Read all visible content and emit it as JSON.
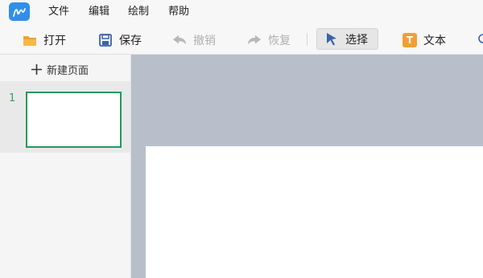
{
  "menu": {
    "items": [
      {
        "label": "文件"
      },
      {
        "label": "编辑"
      },
      {
        "label": "绘制"
      },
      {
        "label": "帮助"
      }
    ]
  },
  "toolbar": {
    "open": {
      "label": "打开",
      "icon": "folder-icon"
    },
    "save": {
      "label": "保存",
      "icon": "save-icon"
    },
    "undo": {
      "label": "撤销",
      "icon": "undo-icon",
      "state": "disabled"
    },
    "redo": {
      "label": "恢复",
      "icon": "redo-icon",
      "state": "disabled"
    },
    "select": {
      "label": "选择",
      "icon": "cursor-icon",
      "state": "selected"
    },
    "text": {
      "label": "文本",
      "icon": "text-tool-icon",
      "glyph": "T"
    }
  },
  "sidebar": {
    "new_page_label": "新建页面",
    "pages": [
      {
        "number": "1"
      }
    ]
  },
  "colors": {
    "accent_green": "#1f9a5f",
    "canvas_bg": "#b8bfcb",
    "logo_blue": "#2f8fea",
    "folder_orange": "#f0a030",
    "cursor_blue": "#3a64a8"
  }
}
